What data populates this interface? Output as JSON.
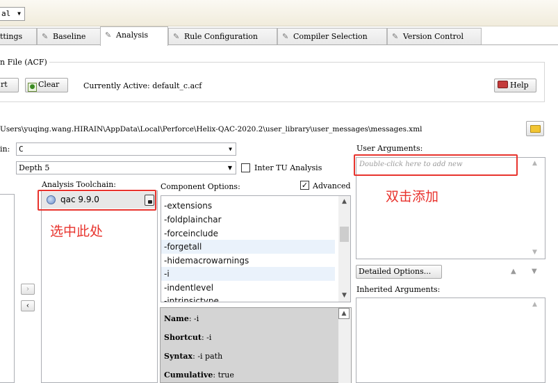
{
  "window": {
    "preset_value": "al"
  },
  "tabs": [
    {
      "label": "ttings",
      "icon": "wrench-icon"
    },
    {
      "label": "Baseline",
      "icon": "wrench-icon"
    },
    {
      "label": "Analysis",
      "icon": "wrench-icon",
      "active": true
    },
    {
      "label": "Rule Configuration",
      "icon": "wrench-icon"
    },
    {
      "label": "Compiler Selection",
      "icon": "wrench-icon"
    },
    {
      "label": "Version Control",
      "icon": "wrench-icon"
    }
  ],
  "acf": {
    "group_title": "n File (ACF)",
    "import_label": "rt",
    "clear_label": "Clear",
    "currently_active": "Currently Active: default_c.acf",
    "help_label": "Help"
  },
  "messages_path": "Users\\yuqing.wang.HIRAIN\\AppData\\Local\\Perforce\\Helix-QAC-2020.2\\user_library\\user_messages\\messages.xml",
  "toolchain": {
    "chain_label": "in:",
    "chain_value": "C",
    "depth_value": "Depth 5",
    "inter_tu_label": "Inter TU Analysis",
    "inter_tu_checked": false,
    "analysis_toolchain_label": "Analysis Toolchain:",
    "items": [
      {
        "label": "qac 9.9.0",
        "icon": "qac-component-icon",
        "lock_icon": "lock-icon"
      }
    ],
    "add_arrow": "›",
    "remove_arrow": "‹"
  },
  "component_options": {
    "label": "Component Options:",
    "advanced_label": "Advanced",
    "advanced_checked": true,
    "options": [
      "-extensions",
      "-foldplainchar",
      "-forceinclude",
      "-forgetall",
      "-hidemacrowarnings",
      "-i",
      "-indentlevel",
      "-intrinsictype"
    ],
    "details": {
      "name_key": "Name",
      "name_value": "-i",
      "shortcut_key": "Shortcut",
      "shortcut_value": "-i",
      "syntax_key": "Syntax",
      "syntax_value": "-i path",
      "cumulative_key": "Cumulative",
      "cumulative_value": "true"
    }
  },
  "user_arguments": {
    "label": "User Arguments:",
    "placeholder": "Double-click here to add new",
    "detailed_options_label": "Detailed Options...",
    "inherited_label": "Inherited Arguments:"
  },
  "annotations": {
    "select_here": "选中此处",
    "double_click_add": "双击添加",
    "color": "#e8332d"
  }
}
